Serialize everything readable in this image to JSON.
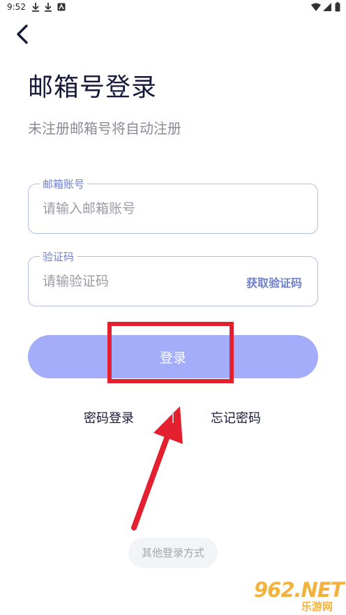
{
  "status_bar": {
    "time": "9:52",
    "icons": [
      "download-icon",
      "download-icon",
      "app-notification-icon",
      "wifi-icon",
      "signal-icon",
      "battery-icon"
    ]
  },
  "header": {
    "back_icon": "chevron-left-icon"
  },
  "title": "邮箱号登录",
  "subtitle": "未注册邮箱号将自动注册",
  "email_field": {
    "label": "邮箱账号",
    "placeholder": "请输入邮箱账号",
    "value": ""
  },
  "code_field": {
    "label": "验证码",
    "placeholder": "请输验证码",
    "value": "",
    "action": "获取验证码"
  },
  "login_button": "登录",
  "links": {
    "password_login": "密码登录",
    "forgot_password": "忘记密码"
  },
  "other_login": "其他登录方式",
  "watermark": {
    "logo": "962.NET",
    "sub": "乐游网"
  },
  "colors": {
    "primary": "#a3adf9",
    "field_border": "#b2bde6",
    "label": "#6e7fd6",
    "title": "#16183a",
    "annotation": "#e3202f"
  }
}
